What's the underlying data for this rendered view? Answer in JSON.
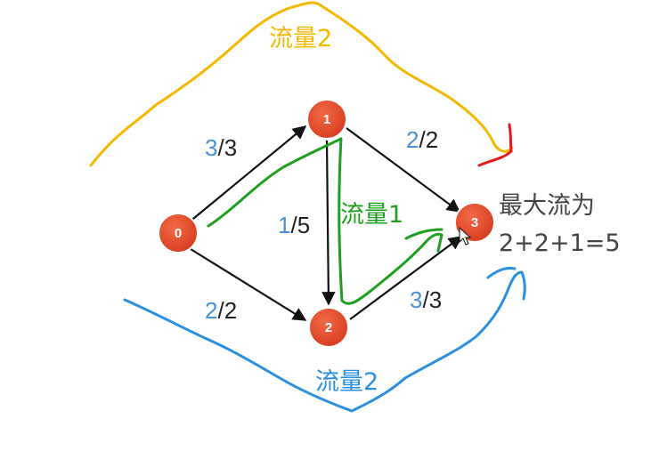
{
  "nodes": [
    {
      "id": "n0",
      "label": "0"
    },
    {
      "id": "n1",
      "label": "1"
    },
    {
      "id": "n2",
      "label": "2"
    },
    {
      "id": "n3",
      "label": "3"
    }
  ],
  "edges": [
    {
      "id": "e01",
      "flow": "3",
      "rest": "/3"
    },
    {
      "id": "e02",
      "flow": "2",
      "rest": "/2"
    },
    {
      "id": "e12",
      "flow": "1",
      "rest": "/5"
    },
    {
      "id": "e13",
      "flow": "2",
      "rest": "/2"
    },
    {
      "id": "e23",
      "flow": "3",
      "rest": "/3"
    }
  ],
  "annotations": {
    "path_top": "流量2",
    "path_middle": "流量1",
    "path_bottom": "流量2",
    "result_title": "最大流为",
    "result_formula": "2+2+1=5"
  },
  "colors": {
    "node_fill": "#e8482a",
    "edge": "#111111",
    "flow_number": "#4a90d9",
    "path_top": "#f5b800",
    "path_middle": "#1ea01e",
    "path_bottom": "#2a8fe0",
    "mark_red": "#e81818"
  }
}
